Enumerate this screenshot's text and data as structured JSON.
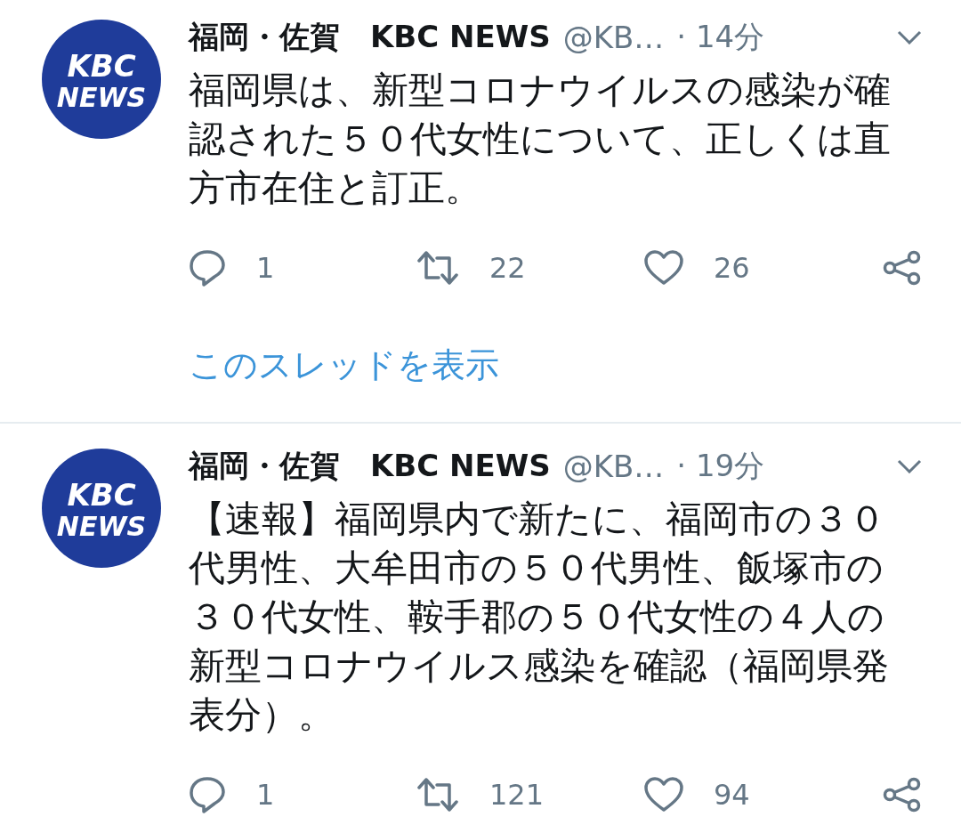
{
  "tweets": [
    {
      "avatar": {
        "logo_top": "KBC",
        "logo_bottom": "NEWS"
      },
      "name": "福岡・佐賀　KBC NEWS",
      "handle": "@KB…",
      "time": "· 14分",
      "text": "福岡県は、新型コロナウイルスの感染が確認された５０代女性について、正しくは直方市在住と訂正。",
      "replies": "1",
      "retweets": "22",
      "likes": "26",
      "thread_link": "このスレッドを表示"
    },
    {
      "avatar": {
        "logo_top": "KBC",
        "logo_bottom": "NEWS"
      },
      "name": "福岡・佐賀　KBC NEWS",
      "handle": "@KB…",
      "time": "· 19分",
      "text": "【速報】福岡県内で新たに、福岡市の３０代男性、大牟田市の５０代男性、飯塚市の３０代女性、鞍手郡の５０代女性の４人の新型コロナウイルス感染を確認（福岡県発表分）。",
      "replies": "1",
      "retweets": "121",
      "likes": "94"
    }
  ]
}
